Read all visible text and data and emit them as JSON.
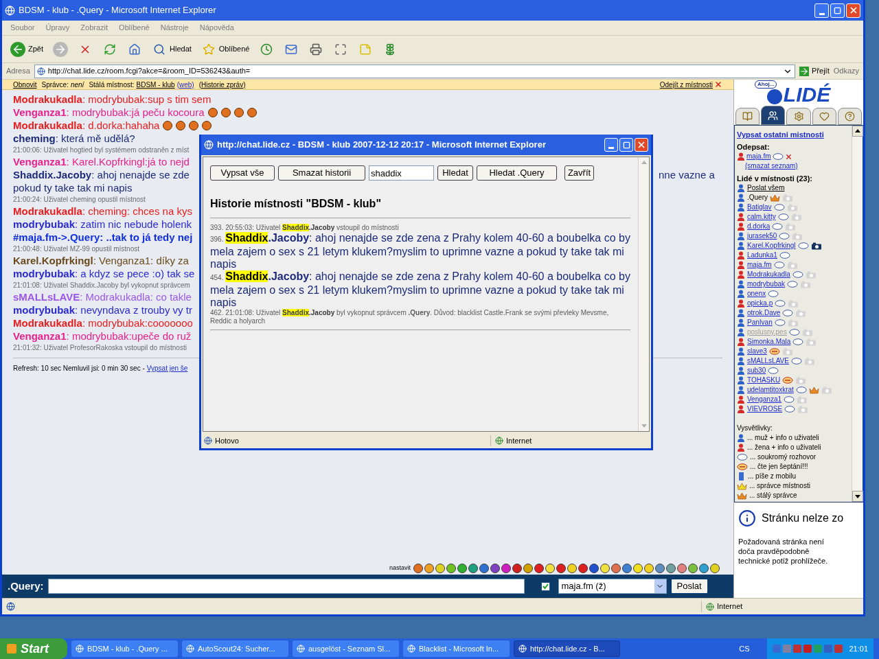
{
  "window": {
    "title": "BDSM - klub - .Query - Microsoft Internet Explorer"
  },
  "menu": [
    "Soubor",
    "Úpravy",
    "Zobrazit",
    "Oblíbené",
    "Nástroje",
    "Nápověda"
  ],
  "toolbar": [
    {
      "kind": "back",
      "label": "Zpět"
    },
    {
      "kind": "forward"
    },
    {
      "kind": "stop"
    },
    {
      "kind": "refresh"
    },
    {
      "kind": "home"
    },
    {
      "kind": "search",
      "label": "Hledat"
    },
    {
      "kind": "favorites",
      "label": "Oblíbené"
    },
    {
      "kind": "history"
    },
    {
      "kind": "mail"
    },
    {
      "kind": "print"
    },
    {
      "kind": "edit"
    },
    {
      "kind": "note"
    },
    {
      "kind": "flower"
    }
  ],
  "address": {
    "label": "Adresa",
    "url": "http://chat.lide.cz/room.fcgi?akce=&room_ID=536243&auth=",
    "go": "Přejít",
    "links": "Odkazy"
  },
  "chat_header": {
    "refresh": "Obnovit",
    "admin_label": "Správce:",
    "admin": "není",
    "room_label": "Stálá místnost:",
    "room": "BDSM - klub",
    "web": "(web)",
    "history": "(Historie zpráv)",
    "leave": "Odejít z místnosti"
  },
  "messages": [
    {
      "kind": "message",
      "nick": "Modrakukadla",
      "color": "#e81c1c",
      "text": ": modrybubak:sup s tim sem"
    },
    {
      "kind": "message",
      "nick": "Venganza1",
      "color": "#e8208c",
      "text": ": modrybubak:já peču kocoura",
      "emoticons": [
        {
          "kind": "grin"
        },
        {
          "kind": "grin"
        },
        {
          "kind": "grin"
        },
        {
          "kind": "grin"
        }
      ]
    },
    {
      "kind": "message",
      "nick": "Modrakukadla",
      "color": "#e81c1c",
      "text": ": d.dorka:hahaha",
      "emoticons": [
        {
          "kind": "grin"
        },
        {
          "kind": "grin"
        },
        {
          "kind": "grin"
        },
        {
          "kind": "grin"
        }
      ]
    },
    {
      "kind": "message",
      "nick": "cheming",
      "color": "#1c2a7a",
      "text": ": která mě udělá?"
    },
    {
      "kind": "system",
      "text": "21:00:06: Uživatel hogtied byl systémem odstraněn z míst"
    },
    {
      "kind": "message",
      "nick": "Venganza1",
      "color": "#e8208c",
      "text": ": Karel.Kopfrkingl:já to nejd"
    },
    {
      "kind": "message",
      "nick": "Shaddix.Jacoby",
      "color": "#1c2a7a",
      "text": ": ahoj nenajde se zde",
      "tail": "nne vazne a"
    },
    {
      "kind": "continuation",
      "color": "#1c2a7a",
      "text": "pokud ty take tak mi napis"
    },
    {
      "kind": "system",
      "text": "21:00:24: Uživatel cheming opustil místnost"
    },
    {
      "kind": "message",
      "nick": "Modrakukadla",
      "color": "#e81c1c",
      "text": ": cheming: chces na kys"
    },
    {
      "kind": "message",
      "nick": "modrybubak",
      "color": "#2a2ad2",
      "text": ": zatim nic nebude holenk"
    },
    {
      "kind": "whisper",
      "color": "#1030e0",
      "text": "#maja.fm->.Query: ..tak to já tedy nej"
    },
    {
      "kind": "system",
      "text": "21:00:48: Uživatel MZ-99 opustil místnost"
    },
    {
      "kind": "message",
      "nick": "Karel.Kopfrkingl",
      "color": "#6a4a1c",
      "text": ": Venganza1: díky za"
    },
    {
      "kind": "message",
      "nick": "modrybubak",
      "color": "#2a2ad2",
      "text": ": a kdyz se pece :o) tak se"
    },
    {
      "kind": "system",
      "text": "21:01:08: Uživatel Shaddix.Jacoby byl vykopnut správcem"
    },
    {
      "kind": "message",
      "nick": "sMALLsLAVE",
      "color": "#9a56e6",
      "text": ": Modrakukadla: co takle"
    },
    {
      "kind": "message",
      "nick": "modrybubak",
      "color": "#2a2ad2",
      "text": ": nevyndava z trouby vy tr"
    },
    {
      "kind": "message",
      "nick": "Modrakukadla",
      "color": "#e81c1c",
      "text": ": modrybubak:cooooooo"
    },
    {
      "kind": "message",
      "nick": "Venganza1",
      "color": "#e8208c",
      "text": ": modrybubak:upeče do ruž"
    },
    {
      "kind": "system",
      "text": "21:01:32: Uživatel ProfesorRakoska vstoupil do místnosti"
    }
  ],
  "footer": {
    "text": "Refresh: 10 sec   Nemluvil jsi: 0 min 30 sec -",
    "link": "Vypsat jen še"
  },
  "smileys_label": "nastavit",
  "input": {
    "label": ".Query:",
    "whisper_checked": true,
    "recipient": "maja.fm (ž)",
    "send": "Poslat"
  },
  "status_bar": {
    "zone": "Internet"
  },
  "sidebar": {
    "logo_bubble": "Ahoj...",
    "logo": "LIDÉ",
    "tabs": [
      {
        "kind": "book",
        "selected": false
      },
      {
        "kind": "people",
        "selected": true
      },
      {
        "kind": "gears",
        "selected": false
      },
      {
        "kind": "hearts",
        "selected": false
      },
      {
        "kind": "help",
        "selected": false
      }
    ],
    "other_rooms": "Vypsat ostatni mistnosti",
    "reply_title": "Odepsat:",
    "reply_user": {
      "name": "maja.fm",
      "kind": "woman"
    },
    "clear_list": "(smazat seznam)",
    "people_title": "Lidé v místnosti (23):",
    "send_all": "Poslat všem",
    "users": [
      {
        "name": ".Query",
        "kind": "man",
        "link": false,
        "private_chat": false,
        "whisper_only": false,
        "crown": true,
        "camera": true,
        "camera_active": false,
        "dimmed": false
      },
      {
        "name": "Batiglav",
        "kind": "man",
        "link": true,
        "private_chat": true,
        "whisper_only": false,
        "crown": false,
        "camera": true,
        "camera_active": false,
        "dimmed": false
      },
      {
        "name": "calm.kitty",
        "kind": "woman",
        "link": true,
        "private_chat": true,
        "whisper_only": false,
        "crown": false,
        "camera": true,
        "camera_active": false,
        "dimmed": false
      },
      {
        "name": "d.dorka",
        "kind": "woman",
        "link": true,
        "private_chat": true,
        "whisper_only": false,
        "crown": false,
        "camera": true,
        "camera_active": false,
        "dimmed": false
      },
      {
        "name": "jurasek50",
        "kind": "man",
        "link": true,
        "private_chat": true,
        "whisper_only": false,
        "crown": false,
        "camera": true,
        "camera_active": false,
        "dimmed": false
      },
      {
        "name": "Karel.Kopfrkingl",
        "kind": "man",
        "link": true,
        "private_chat": true,
        "whisper_only": false,
        "crown": false,
        "camera": true,
        "camera_active": true,
        "dimmed": false
      },
      {
        "name": "Ladunka1",
        "kind": "woman",
        "link": true,
        "private_chat": true,
        "whisper_only": false,
        "crown": false,
        "camera": false,
        "camera_active": false,
        "dimmed": false
      },
      {
        "name": "maja.fm",
        "kind": "woman",
        "link": true,
        "private_chat": true,
        "whisper_only": false,
        "crown": false,
        "camera": true,
        "camera_active": false,
        "dimmed": false
      },
      {
        "name": "Modrakukadla",
        "kind": "woman",
        "link": true,
        "private_chat": true,
        "whisper_only": false,
        "crown": false,
        "camera": true,
        "camera_active": false,
        "dimmed": false
      },
      {
        "name": "modrybubak",
        "kind": "man",
        "link": true,
        "private_chat": true,
        "whisper_only": false,
        "crown": false,
        "camera": true,
        "camera_active": false,
        "dimmed": false
      },
      {
        "name": "onenx",
        "kind": "man",
        "link": true,
        "private_chat": true,
        "whisper_only": false,
        "crown": false,
        "camera": false,
        "camera_active": false,
        "dimmed": false
      },
      {
        "name": "opicka.p",
        "kind": "woman",
        "link": true,
        "private_chat": true,
        "whisper_only": false,
        "crown": false,
        "camera": true,
        "camera_active": false,
        "dimmed": false
      },
      {
        "name": "otrok.Dave",
        "kind": "man",
        "link": true,
        "private_chat": true,
        "whisper_only": false,
        "crown": false,
        "camera": true,
        "camera_active": false,
        "dimmed": false
      },
      {
        "name": "PanIvan",
        "kind": "man",
        "link": true,
        "private_chat": true,
        "whisper_only": false,
        "crown": false,
        "camera": true,
        "camera_active": false,
        "dimmed": false
      },
      {
        "name": "poslusny.pes",
        "kind": "man",
        "link": true,
        "private_chat": true,
        "whisper_only": false,
        "crown": false,
        "camera": true,
        "camera_active": false,
        "dimmed": true
      },
      {
        "name": "Simonka.Mala",
        "kind": "woman",
        "link": true,
        "private_chat": true,
        "whisper_only": false,
        "crown": false,
        "camera": true,
        "camera_active": false,
        "dimmed": false
      },
      {
        "name": "slave3",
        "kind": "man",
        "link": true,
        "private_chat": false,
        "whisper_only": true,
        "crown": false,
        "camera": true,
        "camera_active": false,
        "dimmed": false
      },
      {
        "name": "sMALLsLAVE",
        "kind": "man",
        "link": true,
        "private_chat": true,
        "whisper_only": false,
        "crown": false,
        "camera": true,
        "camera_active": false,
        "dimmed": false
      },
      {
        "name": "sub30",
        "kind": "man",
        "link": true,
        "private_chat": true,
        "whisper_only": false,
        "crown": false,
        "camera": false,
        "camera_active": false,
        "dimmed": false
      },
      {
        "name": "TOHASKU",
        "kind": "man",
        "link": true,
        "private_chat": false,
        "whisper_only": true,
        "crown": false,
        "camera": true,
        "camera_active": false,
        "dimmed": false
      },
      {
        "name": "udelamtitoxkrat",
        "kind": "man",
        "link": true,
        "private_chat": true,
        "whisper_only": false,
        "crown": true,
        "camera": true,
        "camera_active": false,
        "dimmed": false
      },
      {
        "name": "Venganza1",
        "kind": "woman",
        "link": true,
        "private_chat": true,
        "whisper_only": false,
        "crown": false,
        "camera": true,
        "camera_active": false,
        "dimmed": false
      },
      {
        "name": "VIEVROSE",
        "kind": "woman",
        "link": true,
        "private_chat": true,
        "whisper_only": false,
        "crown": false,
        "camera": true,
        "camera_active": false,
        "dimmed": false
      }
    ],
    "legend_title": "Vysvětlivky:",
    "legend": [
      {
        "kind": "man",
        "text": "... muž + info o uživateli"
      },
      {
        "kind": "woman",
        "text": "... žena + info o uživateli"
      },
      {
        "kind": "chat",
        "text": "... soukromý rozhovor"
      },
      {
        "kind": "whisper",
        "text": "... čte jen šeptání!!!"
      },
      {
        "kind": "mobile",
        "text": "... píše z mobilu"
      },
      {
        "kind": "admin",
        "text": "... správce místnosti"
      },
      {
        "kind": "permanent",
        "text": "... stálý správce"
      }
    ],
    "error_title": "Stránku nelze zo",
    "error_text": "Požadovaná stránka není doča pravděpodobně technické potíž prohlížeče."
  },
  "popup": {
    "title": "http://chat.lide.cz - BDSM - klub 2007-12-12 20:17 - Microsoft Internet Explorer",
    "buttons": [
      "Vypsat vše",
      "Smazat historii"
    ],
    "search_value": "shaddix",
    "search_buttons": [
      "Hledat",
      "Hledat .Query"
    ],
    "close": "Zavřít",
    "heading": "Historie místnosti \"BDSM - klub\"",
    "entries": [
      {
        "kind": "system",
        "prefix": "393. 20:55:03: Uživatel",
        "match": "Shaddix",
        "nick_rest": ".Jacoby",
        "text": "vstoupil do místnosti"
      },
      {
        "kind": "message",
        "prefix": "396.",
        "match": "Shaddix",
        "nick_rest": ".Jacoby",
        "text": ": ahoj nenajde se zde zena z Prahy kolem 40-60 a boubelka co by mela zajem o sex s 21 letym klukem?myslim to uprimne vazne a pokud ty take tak mi napis"
      },
      {
        "kind": "message",
        "prefix": "454.",
        "match": "Shaddix",
        "nick_rest": ".Jacoby",
        "text": ": ahoj nenajde se zde zena z Prahy kolem 40-60 a boubelka co by mela zajem o sex s 21 letym klukem?myslim to uprimne vazne a pokud ty take tak mi napis"
      },
      {
        "kind": "system",
        "prefix": "462. 21:01:08: Uživatel",
        "match": "Shaddix",
        "nick_rest": ".Jacoby",
        "text": "byl vykopnut správcem **.Query**. Důvod: blacklist Castle.Frank se svými převleky Mevsme, Reddic a holyarch"
      }
    ],
    "status": "Hotovo",
    "zone": "Internet"
  },
  "taskbar": {
    "start": "Start",
    "tasks": [
      {
        "label": "BDSM - klub - .Query ...",
        "selected": false
      },
      {
        "label": "AutoScout24: Sucher...",
        "selected": false
      },
      {
        "label": "ausgelöst - Seznam Sl...",
        "selected": false
      },
      {
        "label": "Blacklist - Microsoft In...",
        "selected": false
      },
      {
        "label": "http://chat.lide.cz - B...",
        "selected": true
      }
    ],
    "language": "CS",
    "clock": "21:01"
  }
}
